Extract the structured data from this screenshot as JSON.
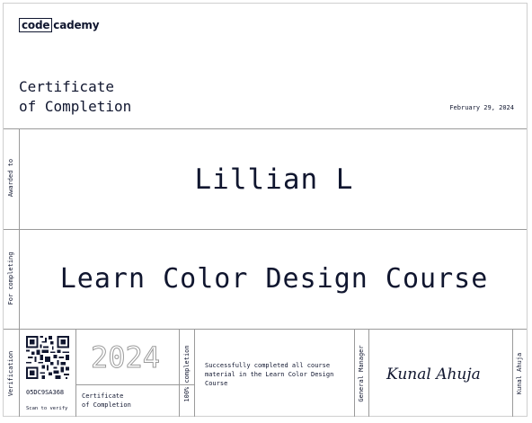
{
  "logo": {
    "part1": "code",
    "part2": "cademy"
  },
  "title": "Certificate\nof Completion",
  "date": "February 29, 2024",
  "awarded_label": "Awarded to",
  "recipient": "Lillian L",
  "completing_label": "For completing",
  "course": "Learn Color Design Course",
  "verification": {
    "label": "Verification",
    "code": "05DC9SA368",
    "scan_text": "Scan to verify"
  },
  "year": "2024",
  "small_title": "Certificate\nof Completion",
  "completion_label": "100% completion",
  "description": "Successfully completed all course material in the Learn Color Design Course",
  "signer": {
    "title": "General Manager",
    "name": "Kunal Ahuja",
    "signature_text": "Kunal Ahuja"
  },
  "colors": {
    "ink": "#10162f",
    "rule": "#9a9a9a"
  }
}
